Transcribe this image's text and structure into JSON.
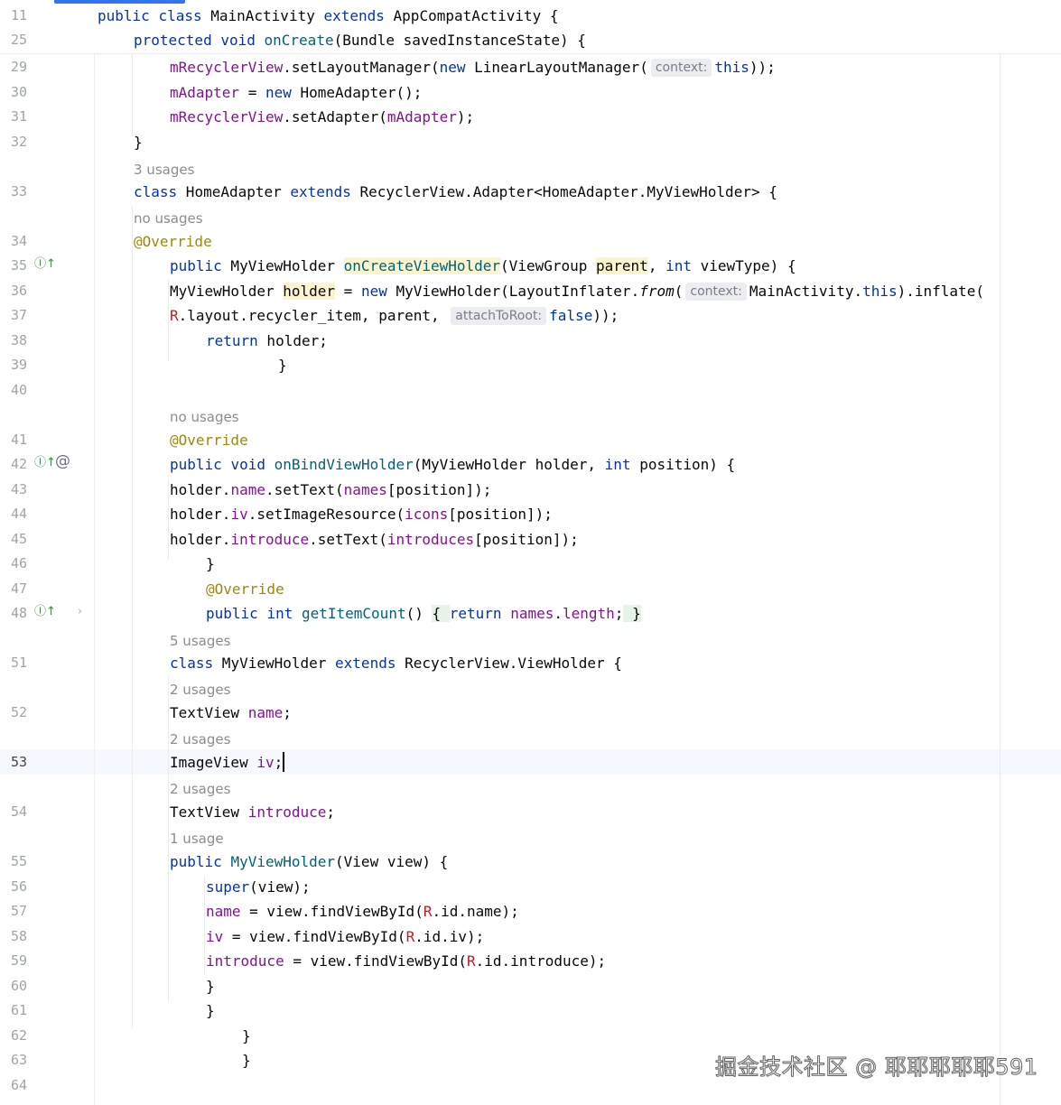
{
  "gutter_markers": {
    "override_icon": "↥↑",
    "mention_icon": "@",
    "fold_icon": "›"
  },
  "sticky": [
    {
      "num": "11",
      "tokens": [
        [
          "kw",
          "public"
        ],
        [
          "t",
          " "
        ],
        [
          "kw",
          "class"
        ],
        [
          "t",
          " MainActivity "
        ],
        [
          "kw",
          "extends"
        ],
        [
          "t",
          " AppCompatActivity {"
        ]
      ]
    },
    {
      "num": "25",
      "tokens": [
        [
          "kw",
          "protected"
        ],
        [
          "t",
          " "
        ],
        [
          "kw",
          "void"
        ],
        [
          "t",
          " "
        ],
        [
          "fn",
          "onCreate"
        ],
        [
          "t",
          "(Bundle savedInstanceState) {"
        ]
      ]
    }
  ],
  "lines": [
    {
      "num": "29",
      "tokens": [
        [
          "fld",
          "mRecyclerView"
        ],
        [
          "t",
          ".setLayoutManager("
        ],
        [
          "kw",
          "new"
        ],
        [
          "t",
          " LinearLayoutManager("
        ],
        [
          "inlay",
          "context:"
        ],
        [
          "kw",
          "this"
        ],
        [
          "t",
          "));"
        ]
      ]
    },
    {
      "num": "30",
      "tokens": [
        [
          "fld",
          "mAdapter"
        ],
        [
          "t",
          " = "
        ],
        [
          "kw",
          "new"
        ],
        [
          "t",
          " HomeAdapter();"
        ]
      ]
    },
    {
      "num": "31",
      "tokens": [
        [
          "fld",
          "mRecyclerView"
        ],
        [
          "t",
          ".setAdapter("
        ],
        [
          "fld",
          "mAdapter"
        ],
        [
          "t",
          ");"
        ]
      ]
    },
    {
      "num": "32",
      "tokens": [
        [
          "t",
          "}"
        ]
      ]
    },
    {
      "hint": "3 usages"
    },
    {
      "num": "33",
      "tokens": [
        [
          "kw",
          "class"
        ],
        [
          "t",
          " HomeAdapter "
        ],
        [
          "kw",
          "extends"
        ],
        [
          "t",
          " RecyclerView.Adapter<HomeAdapter.MyViewHolder> {"
        ]
      ]
    },
    {
      "hint": "no usages"
    },
    {
      "num": "34",
      "tokens": [
        [
          "ann",
          "@Override"
        ]
      ]
    },
    {
      "num": "35",
      "icon": "override",
      "tokens": [
        [
          "kw",
          "public"
        ],
        [
          "t",
          " MyViewHolder "
        ],
        [
          "fn hl-usage",
          "onCreateViewHolder"
        ],
        [
          "t",
          "(ViewGroup "
        ],
        [
          "hl-usage",
          "parent"
        ],
        [
          "t",
          ", "
        ],
        [
          "kw",
          "int"
        ],
        [
          "t",
          " viewType) {"
        ]
      ]
    },
    {
      "num": "36",
      "tokens": [
        [
          "t",
          "MyViewHolder "
        ],
        [
          "hl-usage",
          "holder"
        ],
        [
          "t",
          " = "
        ],
        [
          "kw",
          "new"
        ],
        [
          "t",
          " MyViewHolder(LayoutInflater."
        ],
        [
          "it",
          "from"
        ],
        [
          "t",
          "("
        ],
        [
          "inlay",
          "context:"
        ],
        [
          "t",
          "MainActivity."
        ],
        [
          "kw",
          "this"
        ],
        [
          "t",
          ").inflate("
        ]
      ]
    },
    {
      "num": "37",
      "tokens": [
        [
          "r",
          "R"
        ],
        [
          "t",
          ".layout.recycler_item, parent, "
        ],
        [
          "inlay",
          "attachToRoot:"
        ],
        [
          "kw",
          "false"
        ],
        [
          "t",
          "));"
        ]
      ]
    },
    {
      "num": "38",
      "tokens": [
        [
          "kw",
          "return"
        ],
        [
          "t",
          " holder;"
        ]
      ]
    },
    {
      "num": "39",
      "tokens": [
        [
          "t",
          "}"
        ]
      ]
    },
    {
      "num": "40",
      "tokens": []
    },
    {
      "hint": "no usages"
    },
    {
      "num": "41",
      "tokens": [
        [
          "ann",
          "@Override"
        ]
      ]
    },
    {
      "num": "42",
      "icon": "override",
      "mention": true,
      "tokens": [
        [
          "kw",
          "public"
        ],
        [
          "t",
          " "
        ],
        [
          "kw",
          "void"
        ],
        [
          "t",
          " "
        ],
        [
          "fn",
          "onBindViewHolder"
        ],
        [
          "t",
          "(MyViewHolder holder, "
        ],
        [
          "kw",
          "int"
        ],
        [
          "t",
          " position) {"
        ]
      ]
    },
    {
      "num": "43",
      "tokens": [
        [
          "t",
          "holder."
        ],
        [
          "fld",
          "name"
        ],
        [
          "t",
          ".setText("
        ],
        [
          "fld",
          "names"
        ],
        [
          "t",
          "[position]);"
        ]
      ]
    },
    {
      "num": "44",
      "tokens": [
        [
          "t",
          "holder."
        ],
        [
          "fld",
          "iv"
        ],
        [
          "t",
          ".setImageResource("
        ],
        [
          "fld",
          "icons"
        ],
        [
          "t",
          "[position]);"
        ]
      ]
    },
    {
      "num": "45",
      "tokens": [
        [
          "t",
          "holder."
        ],
        [
          "fld",
          "introduce"
        ],
        [
          "t",
          ".setText("
        ],
        [
          "fld",
          "introduces"
        ],
        [
          "t",
          "[position]);"
        ]
      ]
    },
    {
      "num": "46",
      "tokens": [
        [
          "t",
          "}"
        ]
      ]
    },
    {
      "num": "47",
      "tokens": [
        [
          "ann",
          "@Override"
        ]
      ]
    },
    {
      "num": "48",
      "icon": "override",
      "fold": true,
      "tokens": [
        [
          "kw",
          "public"
        ],
        [
          "t",
          " "
        ],
        [
          "kw",
          "int"
        ],
        [
          "t",
          " "
        ],
        [
          "fn",
          "getItemCount"
        ],
        [
          "t",
          "() "
        ],
        [
          "fold-hl",
          "{ "
        ],
        [
          "kw",
          "return"
        ],
        [
          "t",
          " "
        ],
        [
          "fld",
          "names"
        ],
        [
          "t",
          "."
        ],
        [
          "fld",
          "length"
        ],
        [
          "t",
          ";"
        ],
        [
          "fold-hl",
          " }"
        ]
      ]
    },
    {
      "hint": "5 usages"
    },
    {
      "num": "51",
      "tokens": [
        [
          "kw",
          "class"
        ],
        [
          "t",
          " MyViewHolder "
        ],
        [
          "kw",
          "extends"
        ],
        [
          "t",
          " RecyclerView.ViewHolder {"
        ]
      ]
    },
    {
      "hint": "2 usages"
    },
    {
      "num": "52",
      "tokens": [
        [
          "t",
          "TextView "
        ],
        [
          "fld",
          "name"
        ],
        [
          "t",
          ";"
        ]
      ]
    },
    {
      "hint": "2 usages"
    },
    {
      "num": "53",
      "current": true,
      "tokens": [
        [
          "t",
          "ImageView "
        ],
        [
          "fld",
          "iv"
        ],
        [
          "t",
          ";"
        ],
        [
          "caret",
          ""
        ]
      ]
    },
    {
      "hint": "2 usages"
    },
    {
      "num": "54",
      "tokens": [
        [
          "t",
          "TextView "
        ],
        [
          "fld",
          "introduce"
        ],
        [
          "t",
          ";"
        ]
      ]
    },
    {
      "hint": "1 usage"
    },
    {
      "num": "55",
      "tokens": [
        [
          "kw",
          "public"
        ],
        [
          "t",
          " "
        ],
        [
          "fn",
          "MyViewHolder"
        ],
        [
          "t",
          "(View view) {"
        ]
      ]
    },
    {
      "num": "56",
      "tokens": [
        [
          "kw",
          "super"
        ],
        [
          "t",
          "(view);"
        ]
      ]
    },
    {
      "num": "57",
      "tokens": [
        [
          "fld",
          "name"
        ],
        [
          "t",
          " = view.findViewById("
        ],
        [
          "r",
          "R"
        ],
        [
          "t",
          ".id.name);"
        ]
      ]
    },
    {
      "num": "58",
      "tokens": [
        [
          "fld",
          "iv"
        ],
        [
          "t",
          " = view.findViewById("
        ],
        [
          "r",
          "R"
        ],
        [
          "t",
          ".id.iv);"
        ]
      ]
    },
    {
      "num": "59",
      "tokens": [
        [
          "fld",
          "introduce"
        ],
        [
          "t",
          " = view.findViewById("
        ],
        [
          "r",
          "R"
        ],
        [
          "t",
          ".id.introduce);"
        ]
      ]
    },
    {
      "num": "60",
      "tokens": [
        [
          "t",
          "}"
        ]
      ]
    },
    {
      "num": "61",
      "tokens": [
        [
          "t",
          "}"
        ]
      ]
    },
    {
      "num": "62",
      "tokens": [
        [
          "t",
          "}"
        ]
      ]
    },
    {
      "num": "63",
      "tokens": [
        [
          "t",
          "}"
        ]
      ]
    },
    {
      "num": "64",
      "tokens": []
    }
  ],
  "watermark": "掘金技术社区 @ 耶耶耶耶耶591"
}
